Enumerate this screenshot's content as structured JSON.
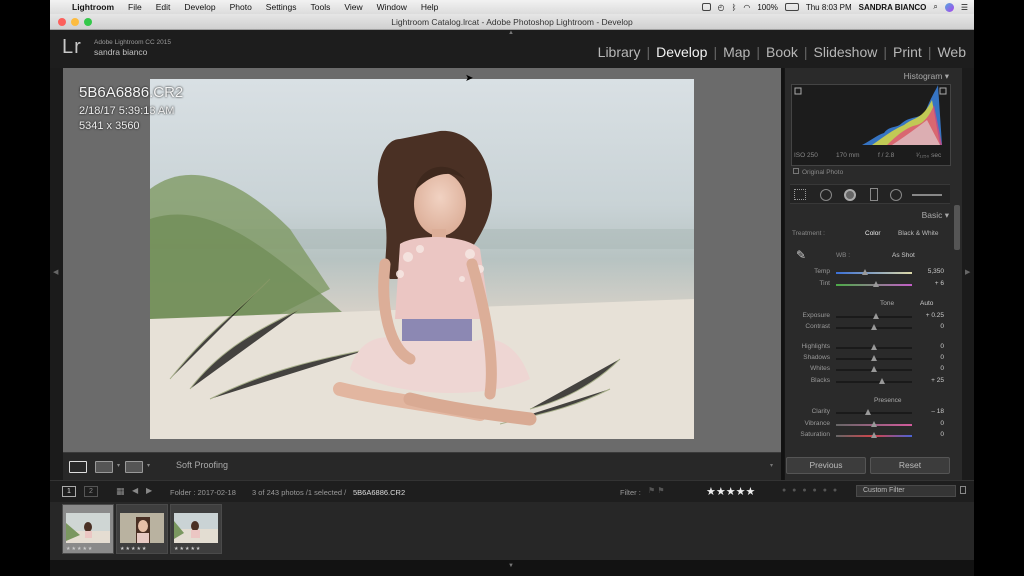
{
  "menubar": {
    "app_name": "Lightroom",
    "items": [
      "File",
      "Edit",
      "Develop",
      "Photo",
      "Settings",
      "Tools",
      "View",
      "Window",
      "Help"
    ],
    "battery": "100%",
    "clock": "Thu 8:03 PM",
    "user": "SANDRA BIANCO"
  },
  "window": {
    "title": "Lightroom Catalog.lrcat - Adobe Photoshop Lightroom - Develop"
  },
  "identity": {
    "logo": "Lr",
    "product": "Adobe Lightroom CC 2015",
    "user": "sandra bianco"
  },
  "modules": [
    "Library",
    "Develop",
    "Map",
    "Book",
    "Slideshow",
    "Print",
    "Web"
  ],
  "active_module": "Develop",
  "photo_info": {
    "filename": "5B6A6886.CR2",
    "datetime": "2/18/17 5:39:13 AM",
    "dimensions": "5341 x 3560"
  },
  "toolbar": {
    "soft_proofing": "Soft Proofing"
  },
  "histogram": {
    "header": "Histogram",
    "iso": "ISO 250",
    "focal": "170 mm",
    "aperture": "f / 2.8",
    "shutter": "¹⁄₁₂₅₀ sec",
    "original_photo": "Original Photo"
  },
  "basic": {
    "header": "Basic",
    "treatment_label": "Treatment :",
    "treatment_color": "Color",
    "treatment_bw": "Black & White",
    "wb_label": "WB :",
    "wb_value": "As Shot",
    "tone_label": "Tone",
    "tone_auto": "Auto",
    "presence_label": "Presence",
    "sliders": {
      "temp": {
        "label": "Temp",
        "value": "5,350",
        "pos": 0.38
      },
      "tint": {
        "label": "Tint",
        "value": "+ 6",
        "pos": 0.52
      },
      "exposure": {
        "label": "Exposure",
        "value": "+ 0.25",
        "pos": 0.52
      },
      "contrast": {
        "label": "Contrast",
        "value": "0",
        "pos": 0.5
      },
      "highlights": {
        "label": "Highlights",
        "value": "0",
        "pos": 0.5
      },
      "shadows": {
        "label": "Shadows",
        "value": "0",
        "pos": 0.5
      },
      "whites": {
        "label": "Whites",
        "value": "0",
        "pos": 0.5
      },
      "blacks": {
        "label": "Blacks",
        "value": "+ 25",
        "pos": 0.6
      },
      "clarity": {
        "label": "Clarity",
        "value": "– 18",
        "pos": 0.42
      },
      "vibrance": {
        "label": "Vibrance",
        "value": "0",
        "pos": 0.5
      },
      "saturation": {
        "label": "Saturation",
        "value": "0",
        "pos": 0.5
      }
    }
  },
  "buttons": {
    "previous": "Previous",
    "reset": "Reset"
  },
  "filmstrip_bar": {
    "page1": "1",
    "page2": "2",
    "folder": "Folder : 2017-02-18",
    "count": "3 of 243 photos /1 selected /",
    "selected_file": "5B6A6886.CR2",
    "filter_label": "Filter :",
    "stars": "★★★★★",
    "custom_filter": "Custom Filter"
  },
  "thumbnails": [
    {
      "stars": "★★★★★"
    },
    {
      "stars": "★★★★★"
    },
    {
      "stars": "★★★★★"
    }
  ],
  "colors": {
    "panel_bg": "#2a2a2a",
    "center_bg": "#6b6b6b",
    "active_module": "#f2f2f2"
  }
}
